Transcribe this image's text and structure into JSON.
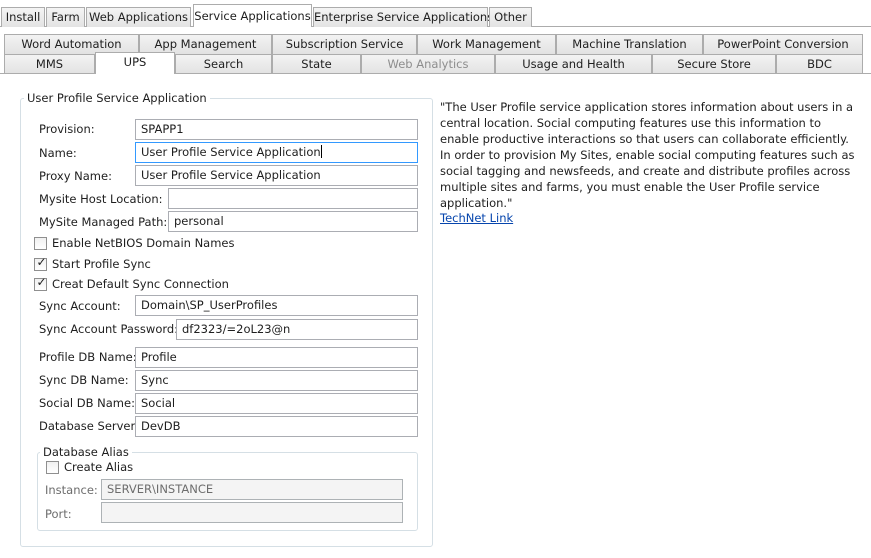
{
  "top_tabs": [
    "Install",
    "Farm",
    "Web Applications",
    "Service Applications",
    "Enterprise Service Applications",
    "Other"
  ],
  "top_tab_selected": "Service Applications",
  "sub_tabs_row1": [
    "Word Automation",
    "App Management",
    "Subscription Service",
    "Work Management",
    "Machine Translation",
    "PowerPoint Conversion"
  ],
  "sub_tabs_row2": [
    "MMS",
    "UPS",
    "Search",
    "State",
    "Web Analytics",
    "Usage and Health",
    "Secure Store",
    "BDC"
  ],
  "sub_tab_selected": "UPS",
  "sub_tab_disabled": [
    "Web Analytics"
  ],
  "form": {
    "group_title": "User Profile Service Application",
    "provision_label": "Provision:",
    "provision_value": "SPAPP1",
    "name_label": "Name:",
    "name_value": "User Profile Service Application",
    "proxy_label": "Proxy Name:",
    "proxy_value": "User Profile Service Application",
    "mysite_host_label": "Mysite Host Location:",
    "mysite_host_value": "",
    "mysite_path_label": "MySite Managed Path:",
    "mysite_path_value": "personal",
    "netbios_label": "Enable NetBIOS Domain Names",
    "netbios_checked": false,
    "start_sync_label": "Start Profile Sync",
    "start_sync_checked": true,
    "default_sync_label": "Creat Default Sync Connection",
    "default_sync_checked": true,
    "sync_account_label": "Sync Account:",
    "sync_account_value": "Domain\\SP_UserProfiles",
    "sync_password_label": "Sync Account Password:",
    "sync_password_value": "df2323/=2oL23@n",
    "profile_db_label": "Profile DB Name:",
    "profile_db_value": "Profile",
    "sync_db_label": "Sync DB Name:",
    "sync_db_value": "Sync",
    "social_db_label": "Social DB Name:",
    "social_db_value": "Social",
    "db_server_label": "Database Server:",
    "db_server_value": "DevDB",
    "alias": {
      "title": "Database Alias",
      "create_label": "Create Alias",
      "create_checked": false,
      "instance_label": "Instance:",
      "instance_value": "SERVER\\INSTANCE",
      "port_label": "Port:",
      "port_value": ""
    }
  },
  "description": "\"The User Profile service application stores information about users in a central location. Social computing features use this information to enable productive interactions so that users can collaborate efficiently. In order to provision My Sites, enable social computing features such as social tagging and newsfeeds, and create and distribute profiles across multiple sites and farms, you must enable the User Profile service application.\"",
  "link_text": "TechNet Link",
  "colors": {
    "link": "#0645ad",
    "border": "#acacac",
    "focus": "#3399ff"
  }
}
